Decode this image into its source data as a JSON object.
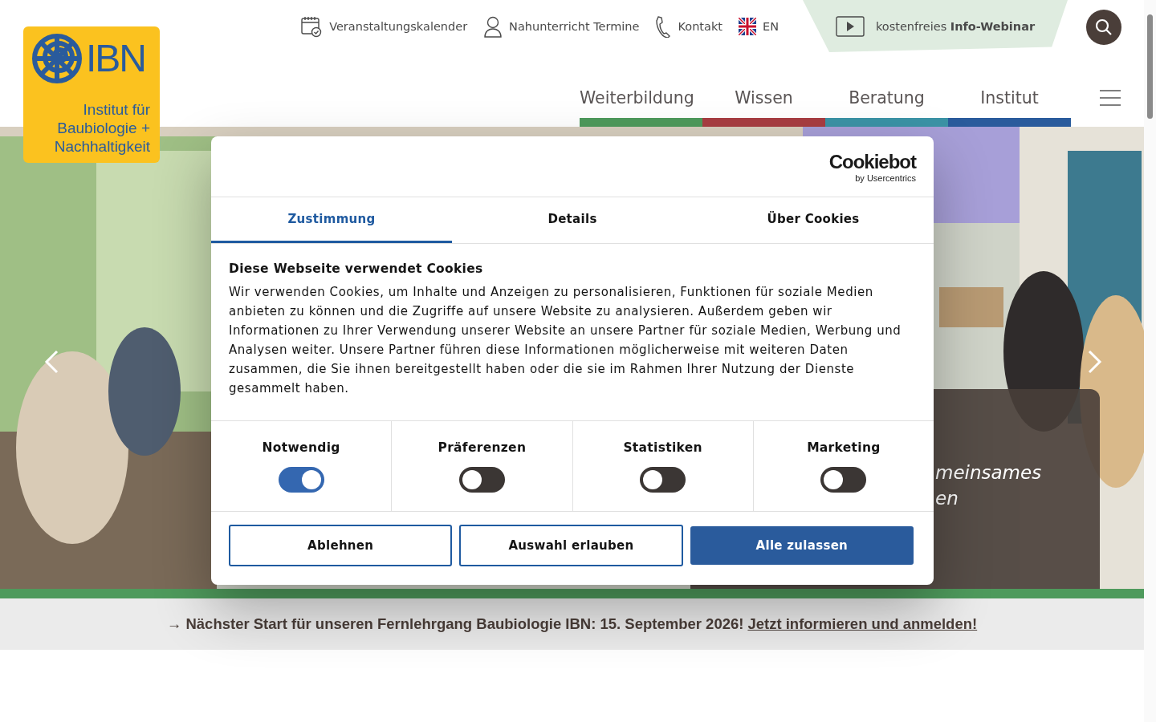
{
  "logo": {
    "mark": "IBN",
    "lines": [
      "Institut für",
      "Baubiologie +",
      "Nachhaltigkeit"
    ]
  },
  "top_links": [
    {
      "kind": "calendar",
      "label": "Veranstaltungskalender"
    },
    {
      "kind": "person",
      "label": "Nahunterricht Termine"
    },
    {
      "kind": "phone",
      "label": "Kontakt"
    },
    {
      "kind": "flag",
      "label": "EN"
    }
  ],
  "webinar": {
    "text": "kostenfreies **Info-Webinar**"
  },
  "nav": [
    {
      "label": "Weiterbildung",
      "color": "#4e9a5c"
    },
    {
      "label": "Wissen",
      "color": "#a83d42"
    },
    {
      "label": "Beratung",
      "color": "#3b93a6"
    },
    {
      "label": "Institut",
      "color": "#2a5b9c"
    }
  ],
  "hero": {
    "caption": [
      "meinsames",
      "en"
    ]
  },
  "cookie_dialog": {
    "brand": "Cookiebot",
    "brand_sub": "by Usercentrics",
    "tabs": [
      {
        "label": "Zustimmung",
        "selected": true
      },
      {
        "label": "Details",
        "selected": false
      },
      {
        "label": "Über Cookies",
        "selected": false
      }
    ],
    "heading": "Diese Webseite verwendet Cookies",
    "body": "Wir verwenden Cookies, um Inhalte und Anzeigen zu personalisieren, Funktionen für soziale Medien anbieten zu können und die Zugriffe auf unsere Website zu analysieren. Außerdem geben wir Informationen zu Ihrer Verwendung unserer Website an unsere Partner für soziale Medien, Werbung und Analysen weiter. Unsere Partner führen diese Informationen möglicherweise mit weiteren Daten zusammen, die Sie ihnen bereitgestellt haben oder die sie im Rahmen Ihrer Nutzung der Dienste gesammelt haben.",
    "categories": [
      {
        "label": "Notwendig",
        "checked": true
      },
      {
        "label": "Präferenzen",
        "checked": false
      },
      {
        "label": "Statistiken",
        "checked": false
      },
      {
        "label": "Marketing",
        "checked": false
      }
    ],
    "buttons": [
      {
        "label": "Ablehnen",
        "kind": "outline"
      },
      {
        "label": "Auswahl erlauben",
        "kind": "outline"
      },
      {
        "label": "Alle zulassen",
        "kind": "primary"
      }
    ]
  },
  "announcement": {
    "text": "→ Nächster Start für unseren Fernlehrgang Baubiologie IBN: 15. September 2026!",
    "link": "Jetzt informieren und anmelden!"
  }
}
